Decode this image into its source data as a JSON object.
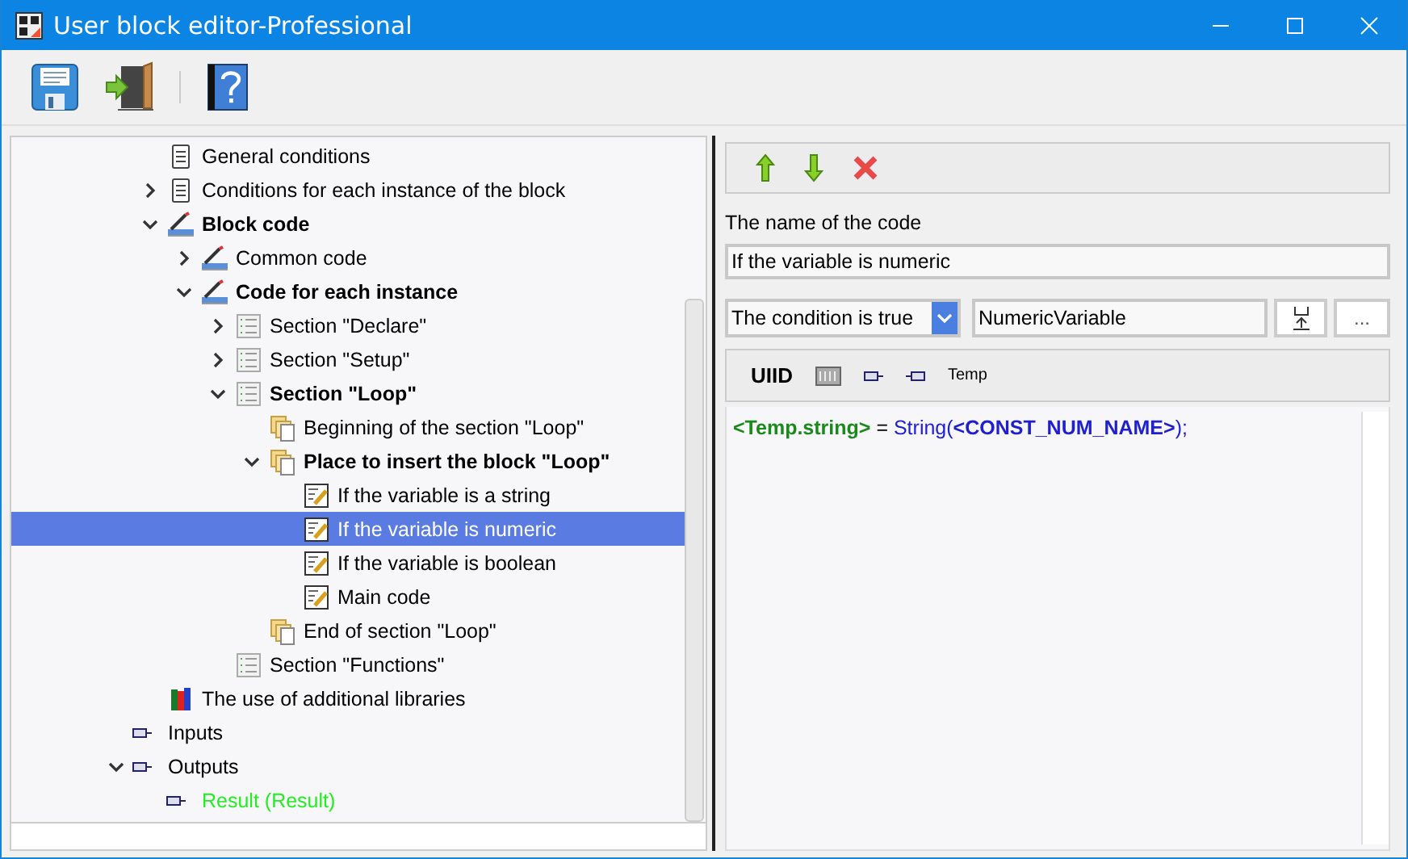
{
  "window": {
    "title": "User block editor-Professional"
  },
  "toolbar": {
    "buttons": [
      {
        "kind": "save"
      },
      {
        "kind": "exit"
      },
      {
        "kind": "help"
      }
    ]
  },
  "tree": {
    "continued_children": [
      {
        "label": "General conditions",
        "kind": "clipboard",
        "bold": false,
        "selected": false
      },
      {
        "label": "Conditions for each instance of the block",
        "kind": "clipboard",
        "bold": false,
        "selected": false,
        "expanded": false
      },
      {
        "label": "Block code",
        "kind": "code",
        "bold": true,
        "selected": false,
        "expanded": true,
        "children": [
          {
            "label": "Common code",
            "kind": "code",
            "bold": false,
            "selected": false,
            "expanded": false
          },
          {
            "label": "Code for each instance",
            "kind": "code",
            "bold": true,
            "selected": false,
            "expanded": true,
            "children": [
              {
                "label": "Section \"Declare\"",
                "kind": "section",
                "bold": false,
                "selected": false,
                "expanded": false
              },
              {
                "label": "Section \"Setup\"",
                "kind": "section",
                "bold": false,
                "selected": false,
                "expanded": false
              },
              {
                "label": "Section \"Loop\"",
                "kind": "section",
                "bold": true,
                "selected": false,
                "expanded": true,
                "children": [
                  {
                    "label": "Beginning of the section \"Loop\"",
                    "kind": "pages",
                    "bold": false,
                    "selected": false
                  },
                  {
                    "label": "Place to insert the block \"Loop\"",
                    "kind": "pages",
                    "bold": true,
                    "selected": false,
                    "expanded": true,
                    "children": [
                      {
                        "label": "If the variable is a string",
                        "kind": "note",
                        "bold": false,
                        "selected": false
                      },
                      {
                        "label": "If the variable is numeric",
                        "kind": "note",
                        "bold": false,
                        "selected": true
                      },
                      {
                        "label": "If the variable is boolean",
                        "kind": "note",
                        "bold": false,
                        "selected": false
                      },
                      {
                        "label": "Main code",
                        "kind": "note",
                        "bold": false,
                        "selected": false
                      }
                    ]
                  },
                  {
                    "label": "End of section \"Loop\"",
                    "kind": "pages",
                    "bold": false,
                    "selected": false
                  }
                ]
              },
              {
                "label": "Section \"Functions\"",
                "kind": "section",
                "bold": false,
                "selected": false
              }
            ]
          }
        ]
      },
      {
        "label": "The use of additional libraries",
        "kind": "books",
        "bold": false,
        "selected": false
      }
    ],
    "items": [
      {
        "label": "Inputs",
        "kind": "pin",
        "bold": false,
        "selected": false
      },
      {
        "label": "Outputs",
        "kind": "pin",
        "bold": false,
        "selected": false,
        "expanded": true,
        "children": [
          {
            "label": "Result (Result)",
            "kind": "pin",
            "bold": false,
            "selected": false,
            "color": "#22ee22"
          }
        ]
      }
    ]
  },
  "editor": {
    "actions": [
      {
        "kind": "up"
      },
      {
        "kind": "down"
      },
      {
        "kind": "delete"
      }
    ],
    "name_label": "The name of the code",
    "name_value": "If the variable is numeric",
    "condition": "The condition is true",
    "variable": "NumericVariable",
    "browse_button": "...",
    "insert_items": [
      {
        "kind": "text",
        "label": "UIID"
      },
      {
        "kind": "grid"
      },
      {
        "kind": "input"
      },
      {
        "kind": "output"
      },
      {
        "kind": "small",
        "label": "Temp"
      }
    ],
    "code": [
      {
        "kind": "tag",
        "text": "<Temp.string>"
      },
      {
        "kind": "plain",
        "text": " = "
      },
      {
        "kind": "func",
        "text": "String("
      },
      {
        "kind": "const",
        "text": "<CONST_NUM_NAME>"
      },
      {
        "kind": "func",
        "text": ");"
      }
    ]
  }
}
